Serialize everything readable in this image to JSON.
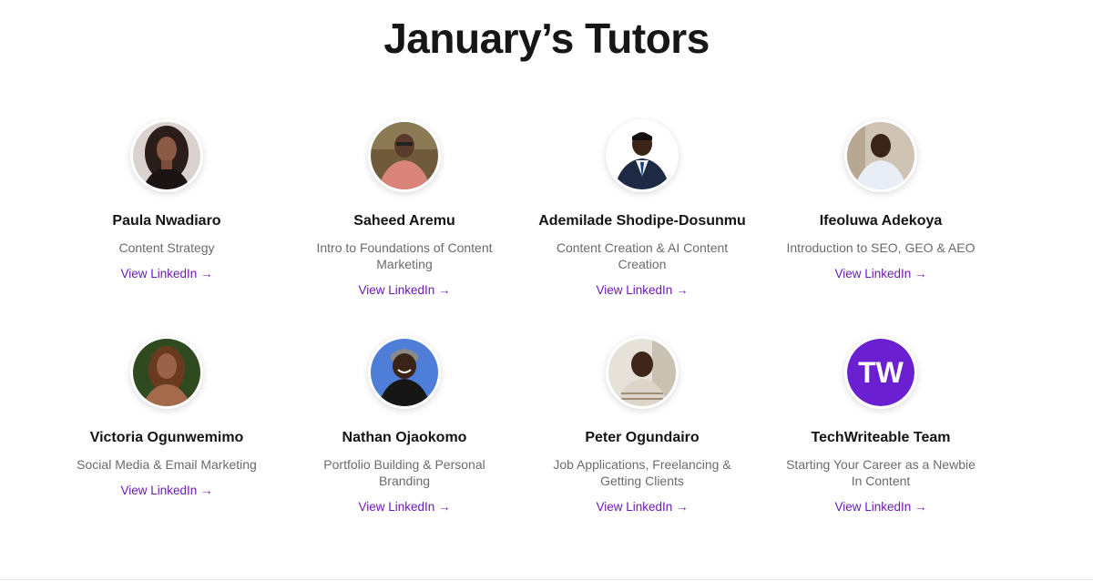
{
  "heading": "January’s Tutors",
  "tutors": [
    {
      "name": "Paula Nwadiaro",
      "topic": "Content Strategy",
      "link": "View LinkedIn →"
    },
    {
      "name": "Saheed Aremu",
      "topic": "Intro to Foundations of Content Marketing",
      "link": "View LinkedIn →"
    },
    {
      "name": "Ademilade Shodipe-Dosunmu",
      "topic": "Content Creation & AI Content Creation",
      "link": "View LinkedIn →"
    },
    {
      "name": "Ifeoluwa Adekoya",
      "topic": "Introduction to SEO, GEO & AEO",
      "link": "View LinkedIn →"
    },
    {
      "name": "Victoria Ogunwemimo",
      "topic": "Social Media & Email Marketing",
      "link": "View LinkedIn →"
    },
    {
      "name": "Nathan Ojaokomo",
      "topic": "Portfolio Building & Personal Branding",
      "link": "View LinkedIn →"
    },
    {
      "name": "Peter Ogundairo",
      "topic": "Job Applications, Freelancing & Getting Clients",
      "link": "View LinkedIn →"
    },
    {
      "name": "TechWriteable Team",
      "topic": "Starting Your Career as a Newbie In Content",
      "link": "View LinkedIn →"
    }
  ],
  "logo_text": "TW",
  "colors": {
    "link": "#6d1ab6",
    "logo_bg": "#6a1fd0"
  }
}
